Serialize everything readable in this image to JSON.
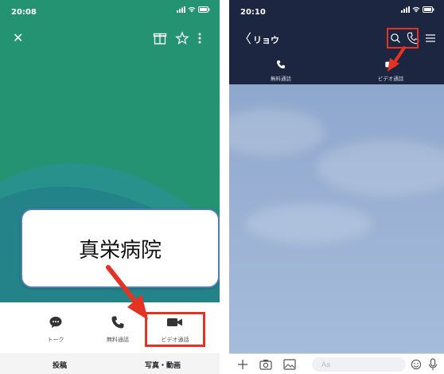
{
  "left_screen": {
    "status_time": "20:08",
    "callout_text": "真栄病院",
    "actions": [
      {
        "label": "トーク",
        "icon": "chat-bubble-icon"
      },
      {
        "label": "無料通話",
        "icon": "phone-icon"
      },
      {
        "label": "ビデオ通話",
        "icon": "video-camera-icon"
      }
    ],
    "tabs": [
      "投稿",
      "写真・動画"
    ],
    "background_color": "#249372",
    "highlight_color": "#e53323"
  },
  "right_screen": {
    "status_time": "20:10",
    "chat_name": "リョウ",
    "call_options": [
      {
        "label": "無料通話",
        "icon": "phone-icon"
      },
      {
        "label": "ビデオ通話",
        "icon": "video-camera-icon"
      }
    ],
    "input_placeholder": "Aa",
    "header_color": "#1c2641",
    "highlight_color": "#e53323"
  }
}
